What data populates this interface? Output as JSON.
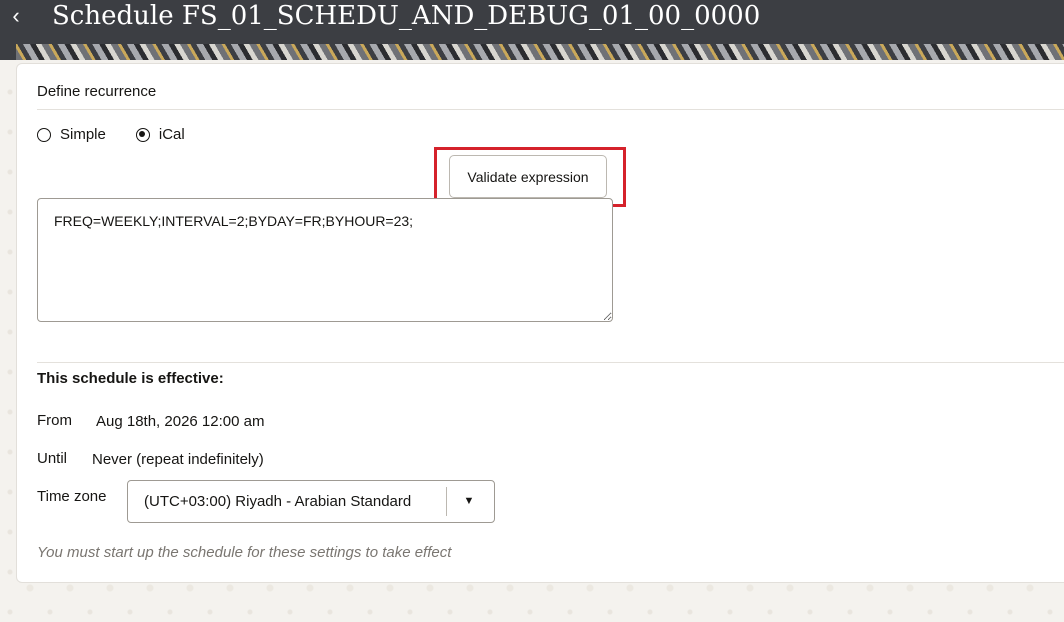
{
  "header": {
    "back_icon": "chevron-left-icon",
    "back_glyph": "‹",
    "title": "Schedule FS_01_SCHEDU_AND_DEBUG_01_00_0000"
  },
  "recurrence": {
    "section_title": "Define recurrence",
    "options": [
      {
        "label": "Simple",
        "checked": false
      },
      {
        "label": "iCal",
        "checked": true
      }
    ],
    "validate_label": "Validate expression",
    "expression": "FREQ=WEEKLY;INTERVAL=2;BYDAY=FR;BYHOUR=23;"
  },
  "effective": {
    "title": "This schedule is effective:",
    "from_label": "From",
    "from_value": "Aug 18th, 2026 12:00 am",
    "until_label": "Until",
    "until_value": "Never (repeat indefinitely)",
    "timezone_label": "Time zone",
    "timezone_value": "(UTC+03:00) Riyadh - Arabian Standard",
    "dropdown_icon": "caret-down-icon",
    "dropdown_glyph": "▼",
    "note": "You must start up the schedule for these settings to take effect"
  },
  "colors": {
    "header_bg": "#3c3e43",
    "highlight": "#d5222b"
  }
}
